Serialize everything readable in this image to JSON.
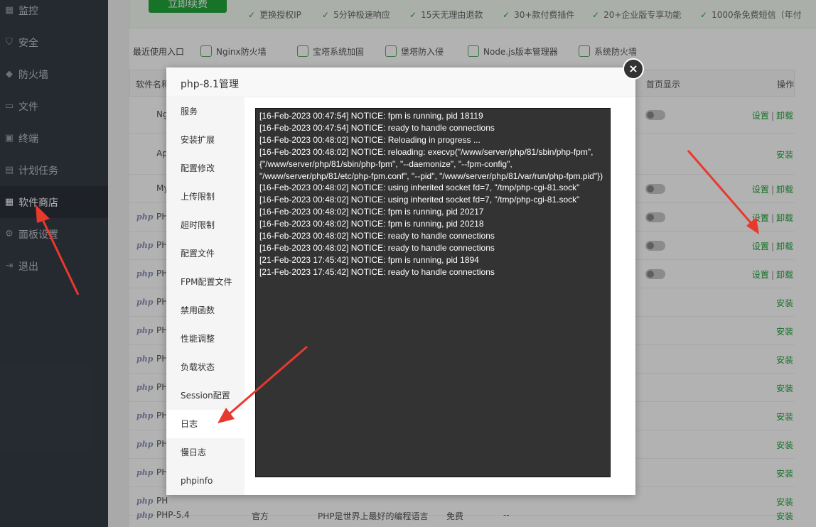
{
  "sidebar": {
    "items": [
      {
        "label": "监控",
        "icon": "monitor-icon"
      },
      {
        "label": "安全",
        "icon": "shield-icon"
      },
      {
        "label": "防火墙",
        "icon": "firewall-icon"
      },
      {
        "label": "文件",
        "icon": "folder-icon"
      },
      {
        "label": "终端",
        "icon": "terminal-icon"
      },
      {
        "label": "计划任务",
        "icon": "calendar-icon"
      },
      {
        "label": "软件商店",
        "icon": "grid-icon"
      },
      {
        "label": "面板设置",
        "icon": "gear-icon"
      },
      {
        "label": "退出",
        "icon": "logout-icon"
      }
    ],
    "active": "软件商店"
  },
  "banner": {
    "renew_label": "立即续费",
    "perks": [
      "更换授权IP",
      "5分钟极速响应",
      "15天无理由退款",
      "30+款付费插件",
      "20+企业版专享功能",
      "1000条免费短信（年付"
    ]
  },
  "recent": {
    "label": "最近使用入口",
    "items": [
      "Nginx防火墙",
      "宝塔系统加固",
      "堡塔防入侵",
      "Node.js版本管理器",
      "系统防火墙"
    ]
  },
  "table": {
    "headers": {
      "name": "软件名称",
      "home_display": "首页显示",
      "action": "操作"
    },
    "rows": [
      {
        "name": "Ng",
        "action": "settings_uninstall"
      },
      {
        "name": "Ap",
        "action": "install"
      },
      {
        "name": "My",
        "action": "settings_uninstall"
      },
      {
        "name": "PH",
        "action": "settings_uninstall"
      },
      {
        "name": "PH",
        "action": "settings_uninstall"
      },
      {
        "name": "PH",
        "action": "settings_uninstall"
      },
      {
        "name": "PH",
        "action": "install"
      },
      {
        "name": "PH",
        "action": "install"
      },
      {
        "name": "PH",
        "action": "install"
      },
      {
        "name": "PH",
        "action": "install"
      },
      {
        "name": "PH",
        "action": "install"
      },
      {
        "name": "PH",
        "action": "install"
      },
      {
        "name": "PH",
        "action": "install"
      },
      {
        "name": "PH",
        "action": "install"
      }
    ],
    "last_row": {
      "logo": "php",
      "name": "PHP-5.4",
      "type": "官方",
      "desc": "PHP是世界上最好的编程语言",
      "price": "免费",
      "expire": "--",
      "action": "安装"
    },
    "labels": {
      "settings": "设置",
      "uninstall": "卸载",
      "install": "安装",
      "sep": "|",
      "php_logo": "php"
    }
  },
  "modal": {
    "title": "php-8.1管理",
    "close": "×",
    "nav": [
      "服务",
      "安装扩展",
      "配置修改",
      "上传限制",
      "超时限制",
      "配置文件",
      "FPM配置文件",
      "禁用函数",
      "性能调整",
      "负载状态",
      "Session配置",
      "日志",
      "慢日志",
      "phpinfo"
    ],
    "active_nav": "日志",
    "log_lines": [
      "[16-Feb-2023 00:47:54] NOTICE: fpm is running, pid 18119",
      "[16-Feb-2023 00:47:54] NOTICE: ready to handle connections",
      "[16-Feb-2023 00:48:02] NOTICE: Reloading in progress ...",
      "[16-Feb-2023 00:48:02] NOTICE: reloading: execvp(\"/www/server/php/81/sbin/php-fpm\", {\"/www/server/php/81/sbin/php-fpm\", \"--daemonize\", \"--fpm-config\", \"/www/server/php/81/etc/php-fpm.conf\", \"--pid\", \"/www/server/php/81/var/run/php-fpm.pid\"})",
      "[16-Feb-2023 00:48:02] NOTICE: using inherited socket fd=7, \"/tmp/php-cgi-81.sock\"",
      "[16-Feb-2023 00:48:02] NOTICE: using inherited socket fd=7, \"/tmp/php-cgi-81.sock\"",
      "[16-Feb-2023 00:48:02] NOTICE: fpm is running, pid 20217",
      "[16-Feb-2023 00:48:02] NOTICE: fpm is running, pid 20218",
      "[16-Feb-2023 00:48:02] NOTICE: ready to handle connections",
      "[16-Feb-2023 00:48:02] NOTICE: ready to handle connections",
      "[21-Feb-2023 17:45:42] NOTICE: fpm is running, pid 1894",
      "[21-Feb-2023 17:45:42] NOTICE: ready to handle connections"
    ]
  },
  "colors": {
    "accent": "#20a53a",
    "sidebar": "#363c46",
    "annotation": "#e8392d"
  }
}
